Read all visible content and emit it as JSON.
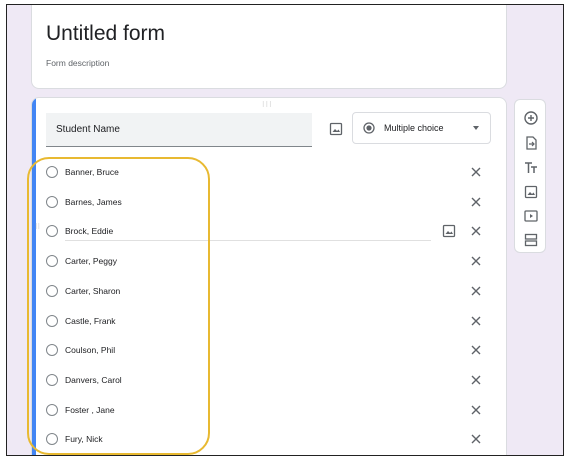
{
  "form": {
    "title": "Untitled form",
    "description": "Form description"
  },
  "question": {
    "title": "Student Name",
    "type": "Multiple choice",
    "options": [
      "Banner, Bruce",
      "Barnes, James",
      "Brock, Eddie",
      "Carter, Peggy",
      "Carter, Sharon",
      "Castle, Frank",
      "Coulson, Phil",
      "Danvers, Carol",
      "Foster , Jane",
      "Fury, Nick"
    ]
  },
  "toolbar": {
    "icons": [
      "add-question-icon",
      "import-questions-icon",
      "add-title-icon",
      "add-image-icon",
      "add-video-icon",
      "add-section-icon"
    ]
  },
  "colors": {
    "accent": "#4285f4",
    "highlight": "#e8b931",
    "background": "#efe9f5"
  }
}
